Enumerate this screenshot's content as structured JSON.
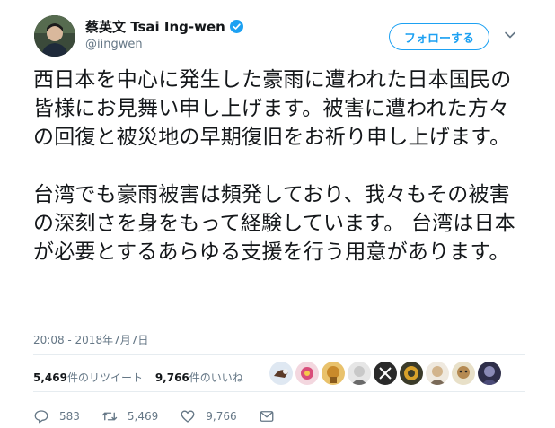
{
  "user": {
    "display_name": "蔡英文 Tsai Ing-wen",
    "handle": "@iingwen",
    "verified": true
  },
  "follow_button": {
    "label": "フォローする"
  },
  "tweet": {
    "paragraphs": [
      "西日本を中心に発生した豪雨に遭われた日本国民の皆様にお見舞い申し上げます。被害に遭われた方々の回復と被災地の早期復旧をお祈り申し上げます。",
      "台湾でも豪雨被害は頻発しており、我々もその被害の深刻さを身をもって経験しています。 台湾は日本が必要とするあらゆる支援を行う用意があります。"
    ],
    "timestamp": "20:08 - 2018年7月7日"
  },
  "stats": {
    "retweets_count": "5,469",
    "retweets_label": "件のリツイート",
    "likes_count": "9,766",
    "likes_label": "件のいいね"
  },
  "actions": {
    "reply_count": "583",
    "retweet_count": "5,469",
    "like_count": "9,766"
  },
  "colors": {
    "accent": "#1da1f2",
    "text": "#14171a",
    "muted": "#657786",
    "divider": "#e6ecf0"
  }
}
